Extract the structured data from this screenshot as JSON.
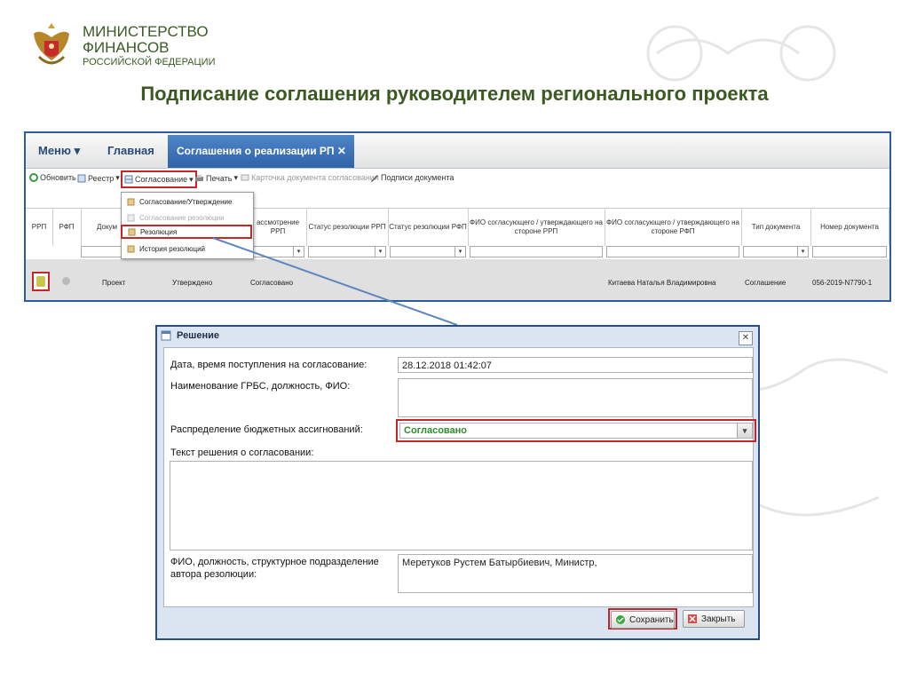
{
  "header": {
    "org_line1": "МИНИСТЕРСТВО",
    "org_line2": "ФИНАНСОВ",
    "org_line3": "РОССИЙСКОЙ ФЕДЕРАЦИИ",
    "slide_title": "Подписание соглашения руководителем регионального проекта"
  },
  "app": {
    "nav": {
      "menu": "Меню",
      "main": "Главная",
      "active_tab": "Соглашения о реализации РП"
    },
    "toolbar": {
      "refresh": "Обновить",
      "registry": "Реестр",
      "agreement": "Согласование",
      "print": "Печать",
      "card": "Карточка документа согласования",
      "signatures": "Подписи документа"
    },
    "dropdown": {
      "items": [
        "Согласование/Утверждение",
        "Согласование резолюции",
        "Резолюция",
        "История резолюций"
      ]
    },
    "grid": {
      "columns": [
        "РРП",
        "РФП",
        "Докум",
        "ассмотрение РРП",
        "Статус резолюции РРП",
        "Статус резолюции РФП",
        "ФИО согласующего / утверждающего на стороне РРП",
        "ФИО согласующего / утверждающего на стороне РФП",
        "Тип документа",
        "Номер документа"
      ],
      "row": {
        "c1": "Проект",
        "c2": "Утверждено",
        "c3": "Согласовано",
        "c4": "Китаева Наталья Владимировна",
        "c5": "Соглашение",
        "c6": "056-2019-N7790-1"
      }
    }
  },
  "dialog": {
    "title": "Решение",
    "labels": {
      "date": "Дата, время поступления на согласование:",
      "grbs": "Наименование ГРБС, должность, ФИО:",
      "distribution": "Распределение бюджетных ассигнований:",
      "decision_text": "Текст решения о согласовании:",
      "author_line1": "ФИО, должность, структурное подразделение",
      "author_line2": "автора резолюции:"
    },
    "values": {
      "date": "28.12.2018 01:42:07",
      "grbs": "",
      "distribution": "Согласовано",
      "decision_text": "",
      "author": "Меретуков Рустем Батырбиевич, Министр,"
    },
    "buttons": {
      "save": "Сохранить",
      "close": "Закрыть"
    }
  },
  "colors": {
    "brand_green": "#3b5a22",
    "accent_blue": "#2f64a8",
    "highlight_red": "#c32727",
    "status_green": "#2e8b2e"
  }
}
